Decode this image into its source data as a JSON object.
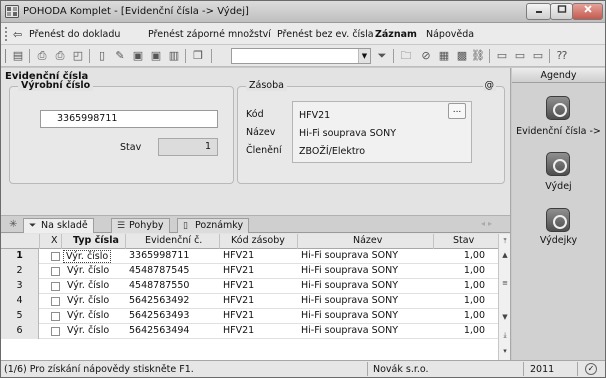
{
  "window": {
    "title": "POHODA Komplet - [Evidenční čísla -> Výdej]"
  },
  "menu": {
    "items": [
      "Přenést do dokladu",
      "Přenést záporné množství",
      "Přenést bez ev. čísla",
      "Záznam",
      "Nápověda"
    ]
  },
  "section": {
    "title": "Evidenční čísla"
  },
  "vyrobni_cislo": {
    "group_title": "Výrobní číslo",
    "value": "3365998711",
    "stav_label": "Stav",
    "stav_value": "1"
  },
  "zasoba": {
    "group_title": "Zásoba",
    "at_sign": "@",
    "kod_label": "Kód",
    "kod_value": "HFV21",
    "nazev_label": "Název",
    "nazev_value": "Hi-Fi souprava SONY",
    "cleneni_label": "Členění",
    "cleneni_value": "ZBOŽÍ/Elektro",
    "more_button": "..."
  },
  "tabs": {
    "star": "✳",
    "items": [
      "Na skladě",
      "Pohyby",
      "Poznámky"
    ]
  },
  "grid": {
    "headers": [
      "X",
      "Typ čísla",
      "Evidenční č.",
      "Kód zásoby",
      "Název",
      "Stav"
    ],
    "rows": [
      {
        "n": "1",
        "typ": "Výr. číslo",
        "cislo": "3365998711",
        "kod": "HFV21",
        "nazev": "Hi-Fi souprava SONY",
        "stav": "1,00"
      },
      {
        "n": "2",
        "typ": "Výr. číslo",
        "cislo": "4548787545",
        "kod": "HFV21",
        "nazev": "Hi-Fi souprava SONY",
        "stav": "1,00"
      },
      {
        "n": "3",
        "typ": "Výr. číslo",
        "cislo": "4548787550",
        "kod": "HFV21",
        "nazev": "Hi-Fi souprava SONY",
        "stav": "1,00"
      },
      {
        "n": "4",
        "typ": "Výr. číslo",
        "cislo": "5642563492",
        "kod": "HFV21",
        "nazev": "Hi-Fi souprava SONY",
        "stav": "1,00"
      },
      {
        "n": "5",
        "typ": "Výr. číslo",
        "cislo": "5642563493",
        "kod": "HFV21",
        "nazev": "Hi-Fi souprava SONY",
        "stav": "1,00"
      },
      {
        "n": "6",
        "typ": "Výr. číslo",
        "cislo": "5642563494",
        "kod": "HFV21",
        "nazev": "Hi-Fi souprava SONY",
        "stav": "1,00"
      }
    ]
  },
  "agendy": {
    "title": "Agendy",
    "items": [
      "Evidenční čísla ->",
      "Výdej",
      "Výdejky"
    ]
  },
  "status": {
    "hint": "(1/6) Pro získání nápovědy stiskněte F1.",
    "user": "Novák s.r.o.",
    "year": "2011"
  }
}
